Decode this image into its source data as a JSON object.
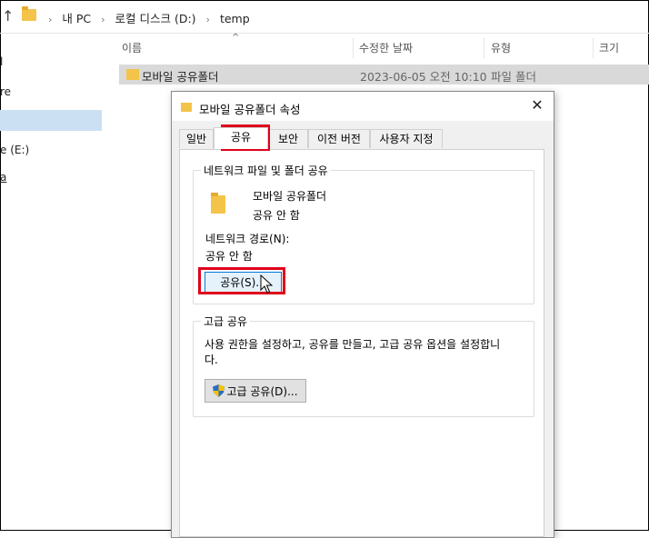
{
  "explorer": {
    "breadcrumb": [
      "내 PC",
      "로컬 디스크 (D:)",
      "temp"
    ],
    "nav_items": [
      "l",
      "re",
      "e (E:)",
      "a"
    ],
    "columns": {
      "name": "이름",
      "date": "수정한 날짜",
      "type": "유형",
      "size": "크기"
    },
    "file": {
      "name": "모바일 공유폴더",
      "date": "2023-06-05 오전 10:10",
      "type": "파일 폴더"
    }
  },
  "dialog": {
    "title": "모바일 공유폴더 속성",
    "tabs": [
      "일반",
      "공유",
      "보안",
      "이전 버전",
      "사용자 지정"
    ],
    "active_tab": "공유",
    "network_group": {
      "legend": "네트워크 파일 및 폴더 공유",
      "folder_name": "모바일 공유폴더",
      "status": "공유 안 함",
      "path_label": "네트워크 경로(N):",
      "path_value": "공유 안 함",
      "share_button": "공유(S)..."
    },
    "advanced_group": {
      "legend": "고급 공유",
      "description_line1": "사용 권한을 설정하고, 공유를 만들고, 고급 공유 옵션을 설정합니",
      "description_line2": "다.",
      "button": "고급 공유(D)..."
    }
  },
  "colors": {
    "highlight": "#e0001b",
    "selection": "#cce0f4",
    "folder": "#f4c44a"
  }
}
